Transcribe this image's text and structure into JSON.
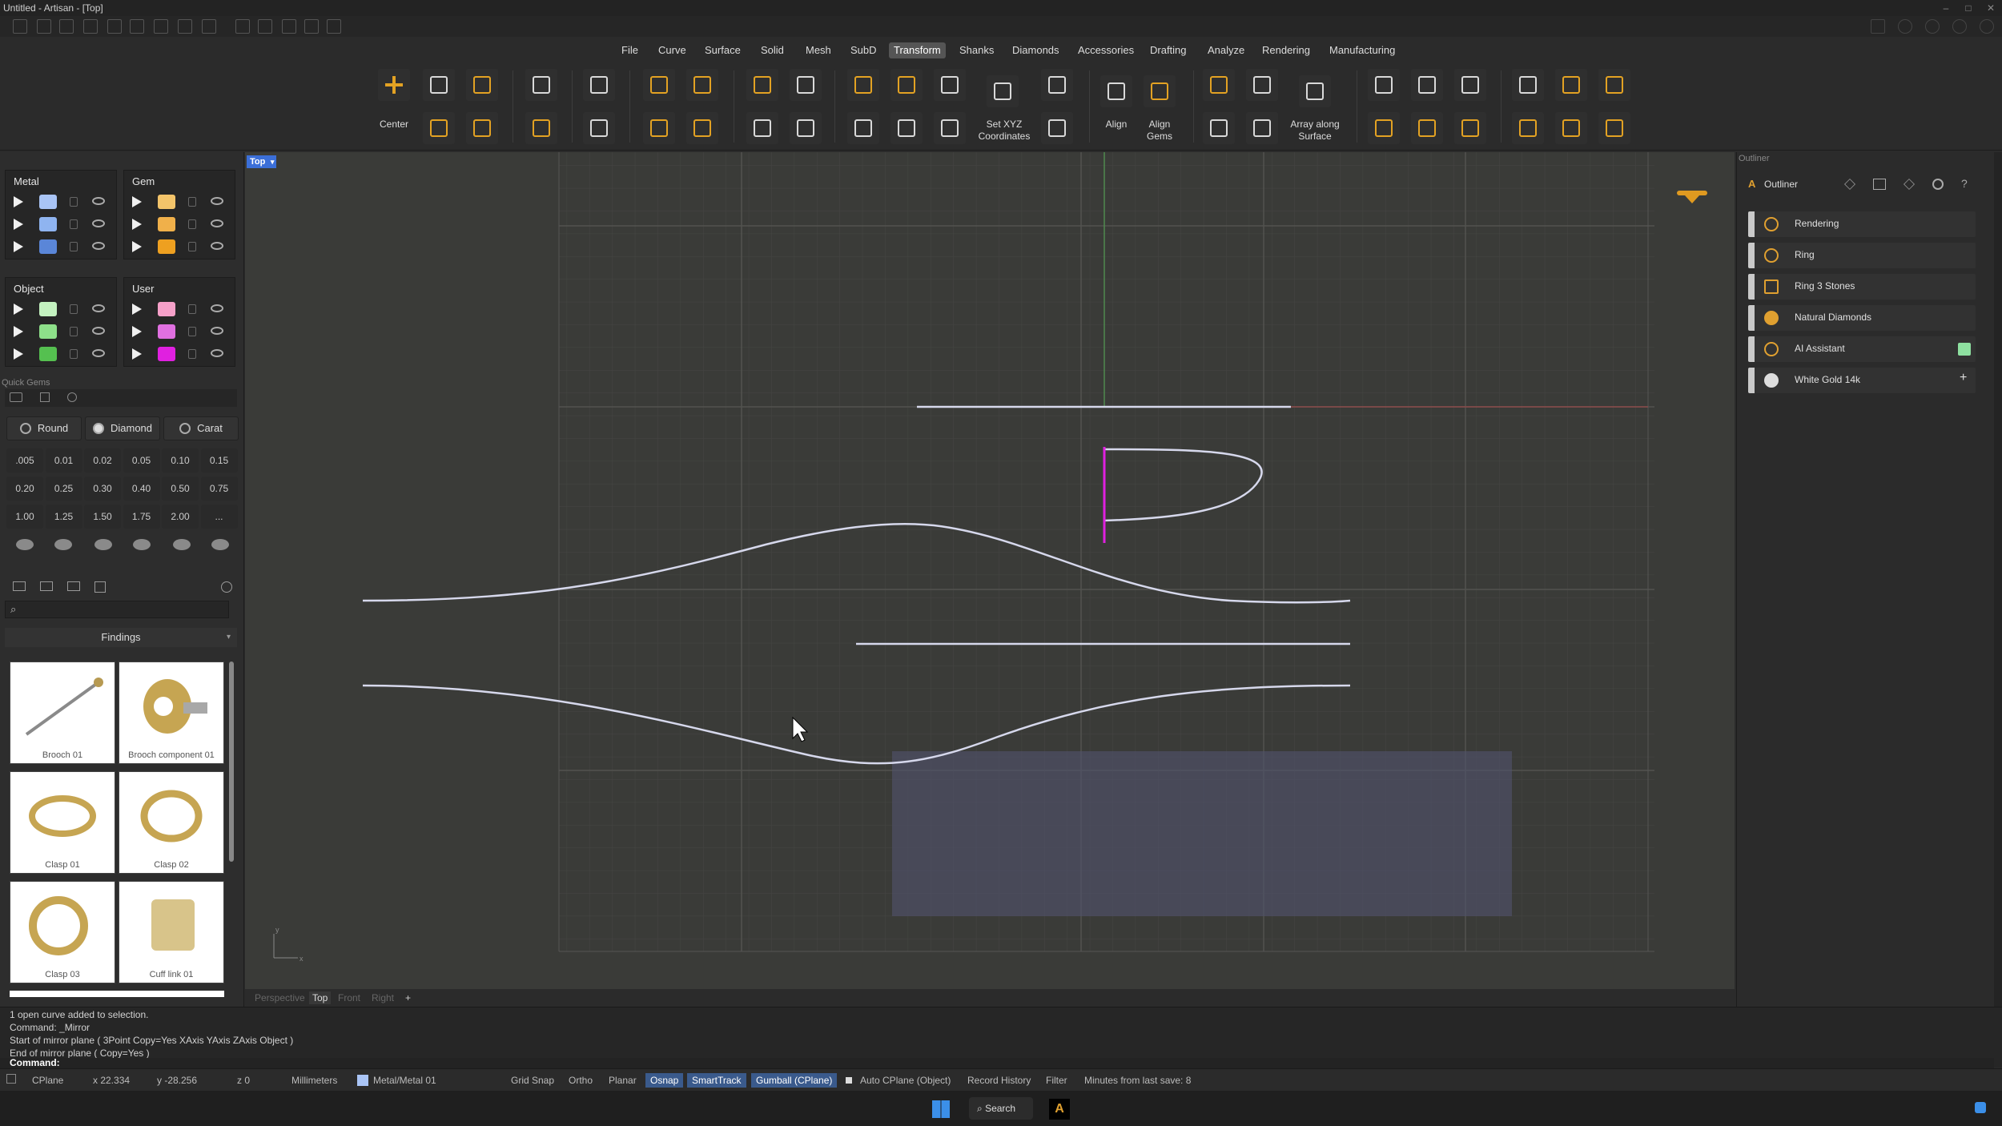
{
  "window": {
    "title": "Untitled - Artisan - [Top]",
    "controls": [
      "–",
      "□",
      "✕"
    ]
  },
  "menu": [
    "File",
    "Curve",
    "Surface",
    "Solid",
    "Mesh",
    "SubD",
    "Transform",
    "Shanks",
    "Diamonds",
    "Accessories",
    "Drafting",
    "Analyze",
    "Rendering",
    "Manufacturing"
  ],
  "menu_active": "Transform",
  "toolbar": {
    "center": "Center",
    "set_xyz": "Set XYZ Coordinates",
    "align": "Align",
    "align_gems": "Align Gems",
    "array_surface": "Array along Surface"
  },
  "layers": {
    "metal_title": "Metal",
    "gem_title": "Gem",
    "object_title": "Object",
    "user_title": "User",
    "metal_colors": [
      "#a9c4f5",
      "#8fb4f0",
      "#5a86d8"
    ],
    "gem_colors": [
      "#f3c46a",
      "#f0b04a",
      "#eea020"
    ],
    "object_colors": [
      "#c4f2c0",
      "#8ee08a",
      "#55c050"
    ],
    "user_colors": [
      "#f5a0c8",
      "#e070e0",
      "#e020e0"
    ]
  },
  "quick_gems": {
    "title": "Quick Gems",
    "shape": "Round",
    "material": "Diamond",
    "unit": "Carat",
    "sizes": [
      ".005",
      "0.01",
      "0.02",
      "0.05",
      "0.10",
      "0.15",
      "0.20",
      "0.25",
      "0.30",
      "0.40",
      "0.50",
      "0.75",
      "1.00",
      "1.25",
      "1.50",
      "1.75",
      "2.00",
      "..."
    ]
  },
  "library": {
    "category": "Findings",
    "items": [
      "Brooch 01",
      "Brooch component 01",
      "Clasp 01",
      "Clasp 02",
      "Clasp 03",
      "Cuff link 01"
    ]
  },
  "viewport": {
    "label": "Top",
    "tabs": [
      "Perspective",
      "Top",
      "Front",
      "Right",
      "+"
    ],
    "active_tab": "Top"
  },
  "outliner": {
    "panel_title": "Outliner",
    "tab": "Outliner",
    "items": [
      "Rendering",
      "Ring",
      "Ring 3 Stones",
      "Natural Diamonds",
      "AI Assistant",
      "White Gold 14k"
    ]
  },
  "command": {
    "history": [
      "1 open curve added to selection.",
      "Command: _Mirror",
      "Start of mirror plane ( 3Point  Copy=Yes  XAxis  YAxis  ZAxis  Object )",
      "End of mirror plane ( Copy=Yes )"
    ],
    "prompt": "Command:"
  },
  "status": {
    "cplane": "CPlane",
    "x": "x 22.334",
    "y": "y -28.256",
    "z": "z 0",
    "units": "Millimeters",
    "layer": "Metal/Metal 01",
    "grid_snap": "Grid Snap",
    "ortho": "Ortho",
    "planar": "Planar",
    "osnap": "Osnap",
    "smarttrack": "SmartTrack",
    "gumball": "Gumball (CPlane)",
    "auto_cplane": "Auto CPlane (Object)",
    "record_history": "Record History",
    "filter": "Filter",
    "last_save": "Minutes from last save: 8"
  },
  "taskbar": {
    "search": "Search"
  }
}
